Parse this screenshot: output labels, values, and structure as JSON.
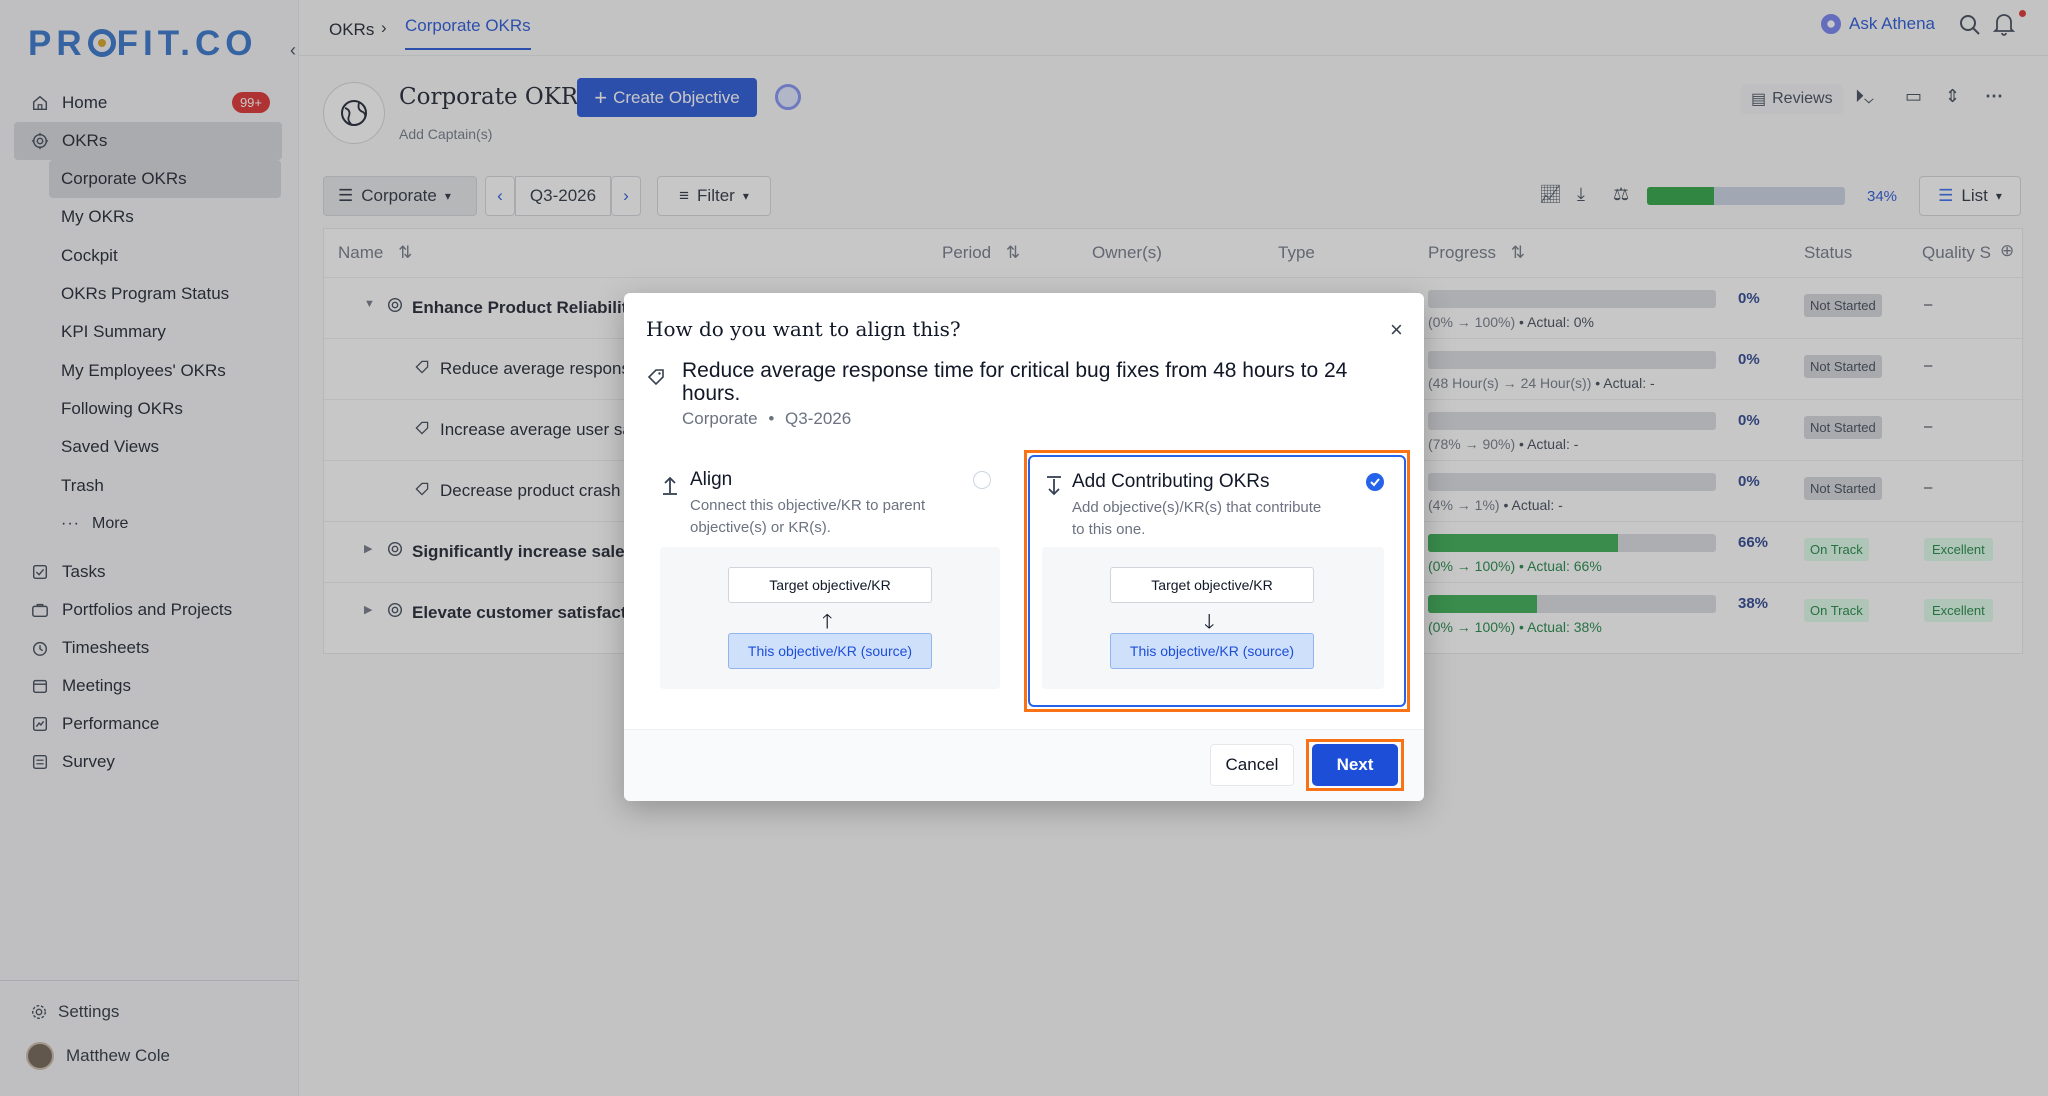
{
  "sidebar": {
    "logo": "PROFIT.CO",
    "items": [
      {
        "label": "Home",
        "badge": "99+"
      },
      {
        "label": "OKRs"
      }
    ],
    "okr_sub": [
      "Corporate OKRs",
      "My OKRs",
      "Cockpit",
      "OKRs Program Status",
      "KPI Summary",
      "My Employees' OKRs",
      "Following OKRs",
      "Saved Views",
      "Trash"
    ],
    "more": "More",
    "lower_items": [
      "Tasks",
      "Portfolios and Projects",
      "Timesheets",
      "Meetings",
      "Performance",
      "Survey"
    ],
    "settings": "Settings",
    "user": "Matthew Cole"
  },
  "topbar": {
    "breadcrumb_root": "OKRs",
    "breadcrumb_sep": "›",
    "breadcrumb_current": "Corporate OKRs",
    "ask_athena": "Ask Athena"
  },
  "header": {
    "title": "Corporate OKRs",
    "add_captain": "Add Captain(s)",
    "create_objective": "Create Objective",
    "reviews": "Reviews"
  },
  "toolbar": {
    "scope": "Corporate",
    "period": "Q3-2026",
    "filter": "Filter",
    "overall_progress": 0.34,
    "overall_pct": "34%",
    "view": "List"
  },
  "table": {
    "columns": [
      "Name",
      "Period",
      "Owner(s)",
      "Type",
      "Progress",
      "Status",
      "Quality S"
    ],
    "rows": [
      {
        "name": "Enhance Product Reliability",
        "bold": true,
        "progress": 0,
        "pct": "0%",
        "range": "(0% → 100%)",
        "actual": "• Actual: 0%",
        "status": "Not Started",
        "quality": "–"
      },
      {
        "name": "Reduce average respons",
        "bold": false,
        "progress": 0,
        "pct": "0%",
        "range": "(48 Hour(s) → 24 Hour(s))",
        "actual": "• Actual: -",
        "status": "Not Started",
        "quality": "–"
      },
      {
        "name": "Increase average user sa",
        "bold": false,
        "progress": 0,
        "pct": "0%",
        "range": "(78% → 90%)",
        "actual": "• Actual: -",
        "status": "Not Started",
        "quality": "–"
      },
      {
        "name": "Decrease product crash",
        "bold": false,
        "progress": 0,
        "pct": "0%",
        "range": "(4% → 1%)",
        "actual": "• Actual: -",
        "status": "Not Started",
        "quality": "–"
      },
      {
        "name": "Significantly increase sales",
        "bold": true,
        "progress": 0.66,
        "pct": "66%",
        "range": "(0% → 100%)",
        "actual": "• Actual: 66%",
        "status": "On Track",
        "quality": "Excellent"
      },
      {
        "name": "Elevate customer satisfacti",
        "bold": true,
        "progress": 0.38,
        "pct": "38%",
        "range": "(0% → 100%)",
        "actual": "• Actual: 38%",
        "status": "On Track",
        "quality": "Excellent"
      }
    ]
  },
  "modal": {
    "title": "How do you want to align this?",
    "kr_text": "Reduce average response time for critical bug fixes from 48 hours to 24 hours.",
    "kr_scope": "Corporate",
    "kr_period": "Q3-2026",
    "align": {
      "title": "Align",
      "desc": "Connect this objective/KR to parent objective(s) or KR(s).",
      "target": "Target objective/KR",
      "source": "This objective/KR (source)",
      "selected": false
    },
    "contribute": {
      "title": "Add Contributing OKRs",
      "desc": "Add objective(s)/KR(s) that contribute to this one.",
      "target": "Target objective/KR",
      "source": "This objective/KR (source)",
      "selected": true
    },
    "cancel": "Cancel",
    "next": "Next"
  },
  "colors": {
    "accent": "#1d4ed8",
    "highlight": "#f97316",
    "progress_green": "#2fa84a"
  }
}
